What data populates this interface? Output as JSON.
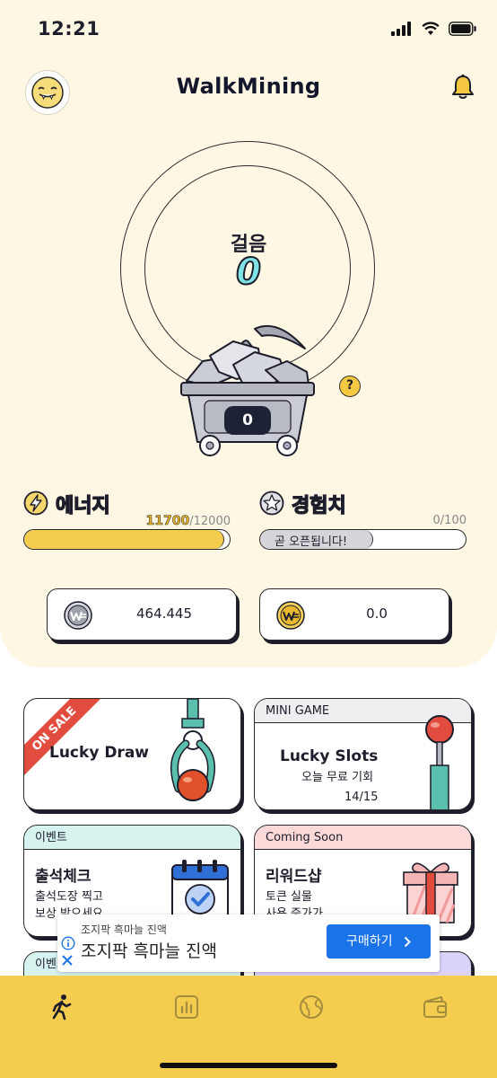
{
  "status_bar": {
    "time": "12:21"
  },
  "header": {
    "title": "WalkMining"
  },
  "steps": {
    "label": "걸음",
    "value": "0"
  },
  "cart": {
    "count": "0"
  },
  "help": {
    "label": "?"
  },
  "energy": {
    "label": "에너지",
    "current": "11700",
    "max": "/12000",
    "fraction": 0.975
  },
  "experience": {
    "label": "경험치",
    "value": "0/100",
    "bar_text": "곧 오픈됩니다!",
    "fraction": 0.55
  },
  "wallets": [
    {
      "amount": "464.445",
      "icon": "silver-coin-icon"
    },
    {
      "amount": "0.0",
      "icon": "gold-coin-icon"
    }
  ],
  "cards": {
    "lucky_draw": {
      "ribbon": "ON SALE",
      "title": "Lucky Draw"
    },
    "lucky_slots": {
      "header": "MINI GAME",
      "title": "Lucky Slots",
      "subtitle": "오늘 무료 기회",
      "count": "14/15"
    },
    "attendance": {
      "header": "이벤트",
      "title": "출석체크",
      "line1": "출석도장 찍고",
      "line2": "보상 받으세요"
    },
    "reward_shop": {
      "header": "Coming Soon",
      "title": "리워드샵",
      "line1": "토큰 실물",
      "line2": "사용 증가가"
    },
    "partial_left": {
      "header": "이벤트"
    }
  },
  "ad": {
    "small_text": "조지팍 흑마늘 진액",
    "big_text": "조지팍 흑마늘 진액",
    "button": "구매하기"
  },
  "tabs": [
    "walk-icon",
    "stats-icon",
    "globe-icon",
    "wallet-icon"
  ],
  "colors": {
    "hero_bg": "#fdf7e4",
    "tab_bar": "#f5cd4e",
    "energy_fill": "#f5cd4e",
    "steps_value": "#7fe3e6"
  }
}
